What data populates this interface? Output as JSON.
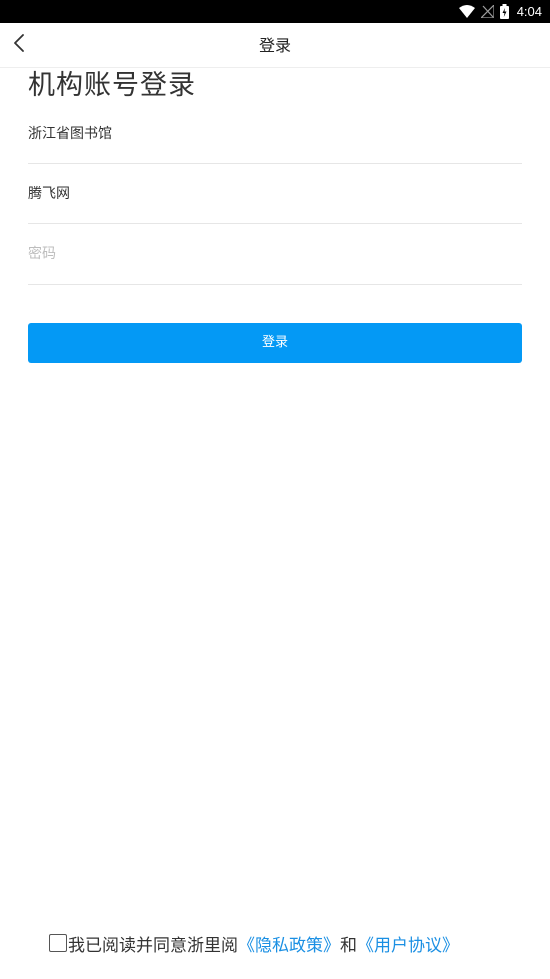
{
  "status_bar": {
    "time": "4:04",
    "icons": [
      "wifi-icon",
      "no-signal-icon",
      "battery-icon"
    ]
  },
  "nav": {
    "back_icon": "back-arrow-icon",
    "title": "登录"
  },
  "main": {
    "title": "机构账号登录",
    "institution": "浙江省图书馆",
    "account": "腾飞网",
    "password_placeholder": "密码",
    "login_button": "登录"
  },
  "agreement": {
    "text": "我已阅读并同意浙里阅",
    "privacy_link": "《隐私政策》",
    "and": "和",
    "terms_link": "《用户协议》",
    "checked": false
  },
  "colors": {
    "accent": "#0499f5",
    "link": "#1a8fe3",
    "status_bar": "#000000"
  }
}
